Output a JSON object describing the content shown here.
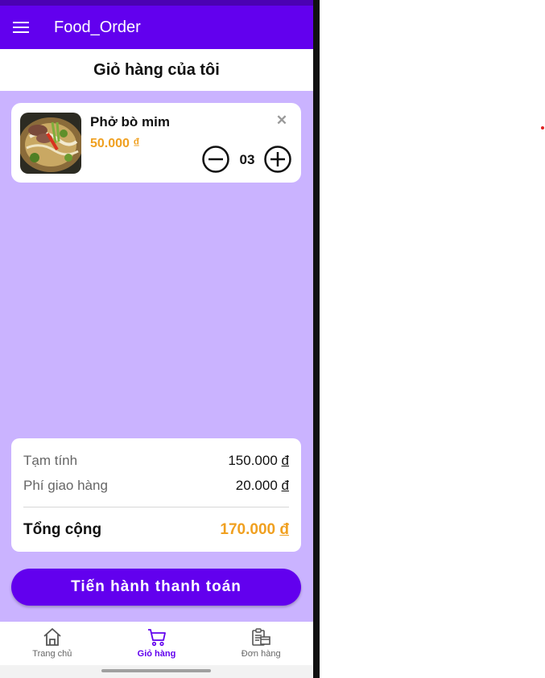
{
  "app": {
    "title": "Food_Order",
    "brand_color": "#6200ee",
    "accent_color": "#f0a020"
  },
  "header": {
    "menu_icon": "hamburger-menu-icon",
    "page_title": "Giỏ hàng của tôi"
  },
  "cart": {
    "items": [
      {
        "name": "Phở bò mim",
        "price": "50.000 ₫",
        "quantity": "03",
        "image": "pho-bo-image",
        "remove_icon": "close-icon",
        "minus_icon": "minus-circle-icon",
        "plus_icon": "plus-circle-icon"
      }
    ]
  },
  "summary": {
    "subtotal_label": "Tạm tính",
    "subtotal_value": "150.000 ",
    "delivery_label": "Phí giao hàng",
    "delivery_value": "20.000 ",
    "total_label": "Tổng cộng",
    "total_value": "170.000 ",
    "currency": "đ"
  },
  "checkout": {
    "label": "Tiến hành thanh toán"
  },
  "bottom_nav": {
    "items": [
      {
        "label": "Trang chủ",
        "icon": "home-icon",
        "active": false
      },
      {
        "label": "Giỏ hàng",
        "icon": "cart-icon",
        "active": true
      },
      {
        "label": "Đơn hàng",
        "icon": "orders-icon",
        "active": false
      }
    ]
  }
}
